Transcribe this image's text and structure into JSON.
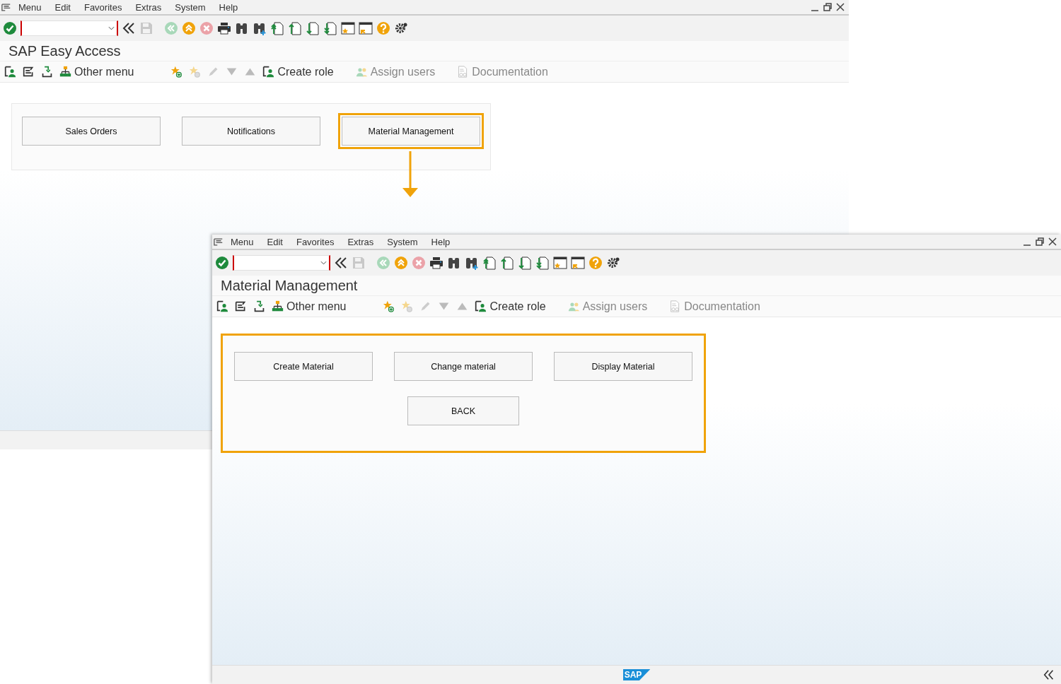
{
  "windows": [
    {
      "menu": [
        "Menu",
        "Edit",
        "Favorites",
        "Extras",
        "System",
        "Help"
      ],
      "title": "SAP Easy Access",
      "toolbar": [
        {
          "label": "Other menu",
          "disabled": false
        },
        {
          "label": "Create role",
          "disabled": false
        },
        {
          "label": "Assign users",
          "disabled": true
        },
        {
          "label": "Documentation",
          "disabled": true
        }
      ],
      "panel": {
        "highlighted": false,
        "buttons": [
          {
            "label": "Sales Orders",
            "highlighted": false
          },
          {
            "label": "Notifications",
            "highlighted": false
          },
          {
            "label": "Material Management",
            "highlighted": true
          }
        ]
      }
    },
    {
      "menu": [
        "Menu",
        "Edit",
        "Favorites",
        "Extras",
        "System",
        "Help"
      ],
      "title": "Material Management",
      "toolbar": [
        {
          "label": "Other menu",
          "disabled": false
        },
        {
          "label": "Create role",
          "disabled": false
        },
        {
          "label": "Assign users",
          "disabled": true
        },
        {
          "label": "Documentation",
          "disabled": true
        }
      ],
      "panel": {
        "highlighted": true,
        "buttons": [
          {
            "label": "Create Material",
            "highlighted": false
          },
          {
            "label": "Change material",
            "highlighted": false
          },
          {
            "label": "Display Material",
            "highlighted": false
          },
          {
            "label": "BACK",
            "highlighted": false
          }
        ]
      },
      "status_bar": {
        "logo": "SAP"
      }
    }
  ]
}
